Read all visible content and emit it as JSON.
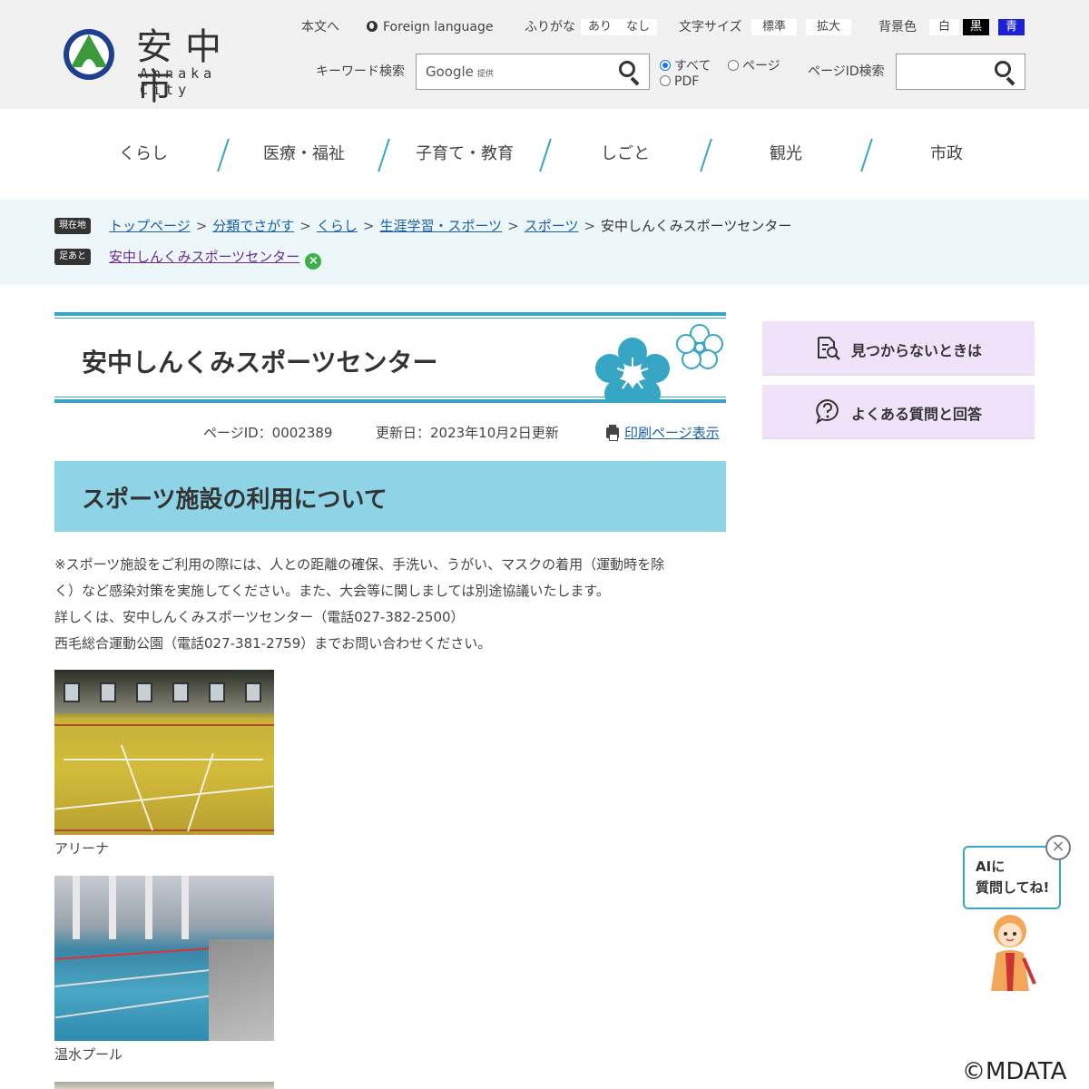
{
  "site": {
    "logo_ja": "安中市",
    "logo_en": "Annaka City"
  },
  "utility": {
    "skip_link": "本文へ",
    "foreign_language": "Foreign language",
    "furigana_label": "ふりがな",
    "furigana_on": "あり",
    "furigana_off": "なし",
    "font_size_label": "文字サイズ",
    "font_standard": "標準",
    "font_large": "拡大",
    "bg_label": "背景色",
    "bg_white": "白",
    "bg_black": "黒",
    "bg_blue": "青"
  },
  "search": {
    "keyword_label": "キーワード検索",
    "google_text": "Google",
    "google_sub": "提供",
    "scope_all": "すべて",
    "scope_page": "ページ",
    "scope_pdf": "PDF",
    "pageid_label": "ページID検索"
  },
  "gnav": [
    "くらし",
    "医療・福祉",
    "子育て・教育",
    "しごと",
    "観光",
    "市政"
  ],
  "breadcrumb": {
    "current_tag": "現在地",
    "trail": [
      "トップページ",
      "分類でさがす",
      "くらし",
      "生涯学習・スポーツ",
      "スポーツ"
    ],
    "current": "安中しんくみスポーツセンター",
    "history_tag": "足あと",
    "history_item": "安中しんくみスポーツセンター"
  },
  "page": {
    "title": "安中しんくみスポーツセンター",
    "page_id": "ページID：0002389",
    "updated": "更新日：2023年10月2日更新",
    "print_link": "印刷ページ表示",
    "section_heading": "スポーツ施設の利用について",
    "paragraph_lines": [
      "※スポーツ施設をご利用の際には、人との距離の確保、手洗い、うがい、マスクの着用（運動時を除",
      "く）など感染対策を実施してください。また、大会等に関しましては別途協議いたします。",
      "詳しくは、安中しんくみスポーツセンター（電話027-382-2500）",
      "西毛総合運動公園（電話027-381-2759）までお問い合わせください。"
    ],
    "photo1_caption": "アリーナ",
    "photo2_caption": "温水プール"
  },
  "side": {
    "not_found": "見つからないときは",
    "faq": "よくある質問と回答"
  },
  "chatbot": {
    "line1": "AIに",
    "line2": "質問してね!"
  },
  "copyright": "©MDATA",
  "colors": {
    "accent": "#37a6c4",
    "section_bg": "#8fd4e6",
    "side_bg": "#f0e2f8",
    "crumb_bg": "#edf7f9",
    "logo_green": "#3a9a3c",
    "logo_blue": "#1f3f8f"
  }
}
